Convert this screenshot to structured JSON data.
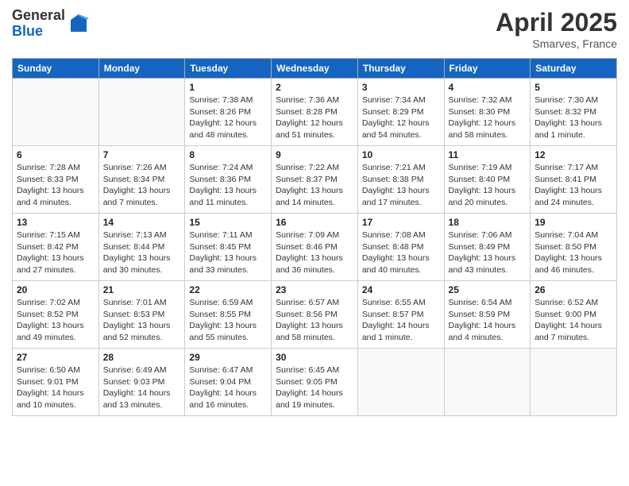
{
  "header": {
    "logo": {
      "line1": "General",
      "line2": "Blue"
    },
    "title": "April 2025",
    "subtitle": "Smarves, France"
  },
  "calendar": {
    "weekdays": [
      "Sunday",
      "Monday",
      "Tuesday",
      "Wednesday",
      "Thursday",
      "Friday",
      "Saturday"
    ],
    "weeks": [
      [
        {
          "day": "",
          "sunrise": "",
          "sunset": "",
          "daylight": ""
        },
        {
          "day": "",
          "sunrise": "",
          "sunset": "",
          "daylight": ""
        },
        {
          "day": "1",
          "sunrise": "Sunrise: 7:38 AM",
          "sunset": "Sunset: 8:26 PM",
          "daylight": "Daylight: 12 hours and 48 minutes."
        },
        {
          "day": "2",
          "sunrise": "Sunrise: 7:36 AM",
          "sunset": "Sunset: 8:28 PM",
          "daylight": "Daylight: 12 hours and 51 minutes."
        },
        {
          "day": "3",
          "sunrise": "Sunrise: 7:34 AM",
          "sunset": "Sunset: 8:29 PM",
          "daylight": "Daylight: 12 hours and 54 minutes."
        },
        {
          "day": "4",
          "sunrise": "Sunrise: 7:32 AM",
          "sunset": "Sunset: 8:30 PM",
          "daylight": "Daylight: 12 hours and 58 minutes."
        },
        {
          "day": "5",
          "sunrise": "Sunrise: 7:30 AM",
          "sunset": "Sunset: 8:32 PM",
          "daylight": "Daylight: 13 hours and 1 minute."
        }
      ],
      [
        {
          "day": "6",
          "sunrise": "Sunrise: 7:28 AM",
          "sunset": "Sunset: 8:33 PM",
          "daylight": "Daylight: 13 hours and 4 minutes."
        },
        {
          "day": "7",
          "sunrise": "Sunrise: 7:26 AM",
          "sunset": "Sunset: 8:34 PM",
          "daylight": "Daylight: 13 hours and 7 minutes."
        },
        {
          "day": "8",
          "sunrise": "Sunrise: 7:24 AM",
          "sunset": "Sunset: 8:36 PM",
          "daylight": "Daylight: 13 hours and 11 minutes."
        },
        {
          "day": "9",
          "sunrise": "Sunrise: 7:22 AM",
          "sunset": "Sunset: 8:37 PM",
          "daylight": "Daylight: 13 hours and 14 minutes."
        },
        {
          "day": "10",
          "sunrise": "Sunrise: 7:21 AM",
          "sunset": "Sunset: 8:38 PM",
          "daylight": "Daylight: 13 hours and 17 minutes."
        },
        {
          "day": "11",
          "sunrise": "Sunrise: 7:19 AM",
          "sunset": "Sunset: 8:40 PM",
          "daylight": "Daylight: 13 hours and 20 minutes."
        },
        {
          "day": "12",
          "sunrise": "Sunrise: 7:17 AM",
          "sunset": "Sunset: 8:41 PM",
          "daylight": "Daylight: 13 hours and 24 minutes."
        }
      ],
      [
        {
          "day": "13",
          "sunrise": "Sunrise: 7:15 AM",
          "sunset": "Sunset: 8:42 PM",
          "daylight": "Daylight: 13 hours and 27 minutes."
        },
        {
          "day": "14",
          "sunrise": "Sunrise: 7:13 AM",
          "sunset": "Sunset: 8:44 PM",
          "daylight": "Daylight: 13 hours and 30 minutes."
        },
        {
          "day": "15",
          "sunrise": "Sunrise: 7:11 AM",
          "sunset": "Sunset: 8:45 PM",
          "daylight": "Daylight: 13 hours and 33 minutes."
        },
        {
          "day": "16",
          "sunrise": "Sunrise: 7:09 AM",
          "sunset": "Sunset: 8:46 PM",
          "daylight": "Daylight: 13 hours and 36 minutes."
        },
        {
          "day": "17",
          "sunrise": "Sunrise: 7:08 AM",
          "sunset": "Sunset: 8:48 PM",
          "daylight": "Daylight: 13 hours and 40 minutes."
        },
        {
          "day": "18",
          "sunrise": "Sunrise: 7:06 AM",
          "sunset": "Sunset: 8:49 PM",
          "daylight": "Daylight: 13 hours and 43 minutes."
        },
        {
          "day": "19",
          "sunrise": "Sunrise: 7:04 AM",
          "sunset": "Sunset: 8:50 PM",
          "daylight": "Daylight: 13 hours and 46 minutes."
        }
      ],
      [
        {
          "day": "20",
          "sunrise": "Sunrise: 7:02 AM",
          "sunset": "Sunset: 8:52 PM",
          "daylight": "Daylight: 13 hours and 49 minutes."
        },
        {
          "day": "21",
          "sunrise": "Sunrise: 7:01 AM",
          "sunset": "Sunset: 8:53 PM",
          "daylight": "Daylight: 13 hours and 52 minutes."
        },
        {
          "day": "22",
          "sunrise": "Sunrise: 6:59 AM",
          "sunset": "Sunset: 8:55 PM",
          "daylight": "Daylight: 13 hours and 55 minutes."
        },
        {
          "day": "23",
          "sunrise": "Sunrise: 6:57 AM",
          "sunset": "Sunset: 8:56 PM",
          "daylight": "Daylight: 13 hours and 58 minutes."
        },
        {
          "day": "24",
          "sunrise": "Sunrise: 6:55 AM",
          "sunset": "Sunset: 8:57 PM",
          "daylight": "Daylight: 14 hours and 1 minute."
        },
        {
          "day": "25",
          "sunrise": "Sunrise: 6:54 AM",
          "sunset": "Sunset: 8:59 PM",
          "daylight": "Daylight: 14 hours and 4 minutes."
        },
        {
          "day": "26",
          "sunrise": "Sunrise: 6:52 AM",
          "sunset": "Sunset: 9:00 PM",
          "daylight": "Daylight: 14 hours and 7 minutes."
        }
      ],
      [
        {
          "day": "27",
          "sunrise": "Sunrise: 6:50 AM",
          "sunset": "Sunset: 9:01 PM",
          "daylight": "Daylight: 14 hours and 10 minutes."
        },
        {
          "day": "28",
          "sunrise": "Sunrise: 6:49 AM",
          "sunset": "Sunset: 9:03 PM",
          "daylight": "Daylight: 14 hours and 13 minutes."
        },
        {
          "day": "29",
          "sunrise": "Sunrise: 6:47 AM",
          "sunset": "Sunset: 9:04 PM",
          "daylight": "Daylight: 14 hours and 16 minutes."
        },
        {
          "day": "30",
          "sunrise": "Sunrise: 6:45 AM",
          "sunset": "Sunset: 9:05 PM",
          "daylight": "Daylight: 14 hours and 19 minutes."
        },
        {
          "day": "",
          "sunrise": "",
          "sunset": "",
          "daylight": ""
        },
        {
          "day": "",
          "sunrise": "",
          "sunset": "",
          "daylight": ""
        },
        {
          "day": "",
          "sunrise": "",
          "sunset": "",
          "daylight": ""
        }
      ]
    ]
  }
}
